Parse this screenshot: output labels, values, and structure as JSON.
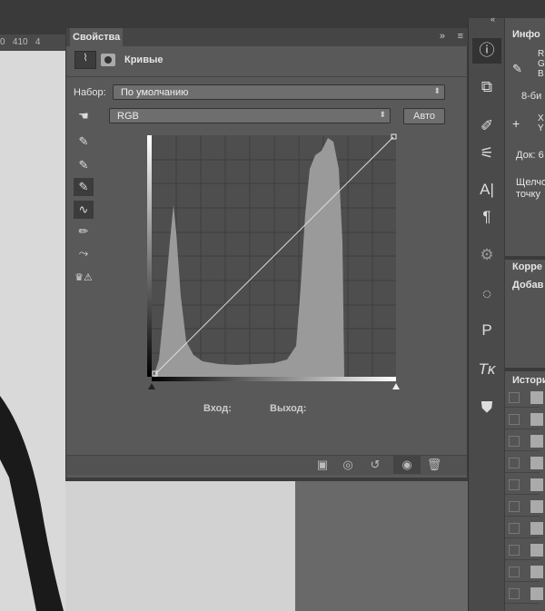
{
  "ruler": {
    "label": "0   410   4"
  },
  "panel": {
    "tab": "Свойства",
    "title": "Кривые",
    "preset_label": "Набор:",
    "preset_value": "По умолчанию",
    "channel_value": "RGB",
    "auto_button": "Авто",
    "input_label": "Вход:",
    "output_label": "Выход:"
  },
  "info_panel": {
    "title": "Инфо",
    "rgb": "R\nG\nB",
    "bit": "8-би",
    "xy": "X\nY",
    "doc": "Док: 6",
    "hint": "Щелчо точку",
    "adjust_title": "Корре",
    "adjust_add": "Добав",
    "history_title": "Истори"
  },
  "icons": {
    "expand": "»",
    "collapse": "«",
    "menu": "≡"
  }
}
